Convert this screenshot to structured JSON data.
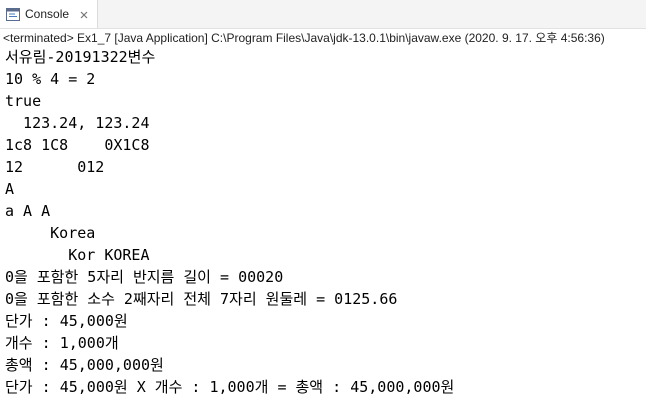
{
  "tab": {
    "label": "Console",
    "icon": "console-icon",
    "close_icon": "close-icon"
  },
  "status_line": "<terminated> Ex1_7 [Java Application] C:\\Program Files\\Java\\jdk-13.0.1\\bin\\javaw.exe (2020. 9. 17. 오후 4:56:36)",
  "output_lines": [
    "서유림-20191322변수",
    "10 % 4 = 2",
    "true",
    "  123.24, 123.24",
    "1c8 1C8    0X1C8",
    "12      012",
    "A",
    "a A A",
    "     Korea",
    "       Kor KOREA",
    "0을 포함한 5자리 반지름 길이 = 00020",
    "0을 포함한 소수 2째자리 전체 7자리 원둘레 = 0125.66",
    "단가 : 45,000원",
    "개수 : 1,000개",
    "총액 : 45,000,000원",
    "단가 : 45,000원 X 개수 : 1,000개 = 총액 : 45,000,000원"
  ]
}
